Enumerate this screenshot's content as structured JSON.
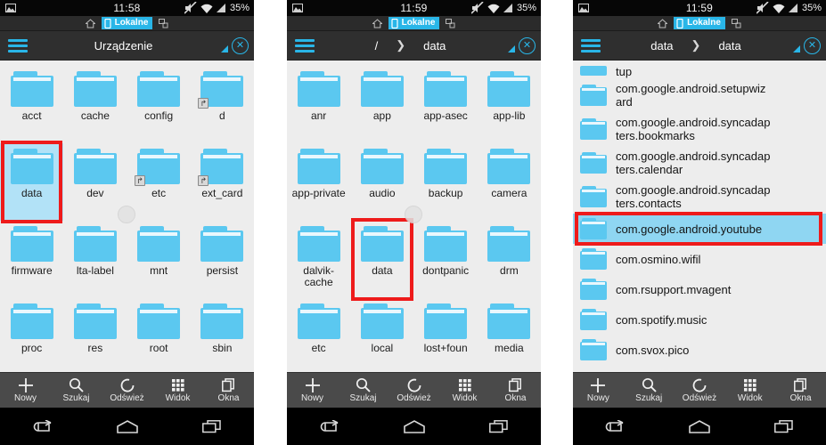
{
  "colors": {
    "accent": "#29b6e8",
    "folder": "#5bc8f0",
    "selection": "#b2e2f7",
    "annotation": "#ee1b1b",
    "content_bg": "#ededed",
    "header_bg": "#2f2f2f",
    "toolbar_bg": "#4a4a4a"
  },
  "statusbar": {
    "clock_panel1": "11:58",
    "clock_panel2": "11:59",
    "clock_panel3": "11:59",
    "battery": "35%",
    "icons": {
      "left": "picture-icon",
      "mute": "mute-icon",
      "wifi": "wifi-icon",
      "signal": "signal-icon"
    }
  },
  "tabstrip": {
    "home_icon": "home-icon",
    "local_tab": "Lokalne",
    "local_icon": "phone-icon",
    "lan_icon": "lan-icon"
  },
  "header": {
    "menu_icon": "hamburger-icon",
    "resize_icon": "resize-handle-icon",
    "close_icon": "close-icon",
    "separator": "❯"
  },
  "toolbar": {
    "items": [
      {
        "label": "Nowy",
        "icon": "plus-icon"
      },
      {
        "label": "Szukaj",
        "icon": "search-icon"
      },
      {
        "label": "Odśwież",
        "icon": "refresh-icon"
      },
      {
        "label": "Widok",
        "icon": "grid-icon"
      },
      {
        "label": "Okna",
        "icon": "windows-icon"
      }
    ]
  },
  "navbar": {
    "back_icon": "back-arrow-icon",
    "home_icon": "home-outline-icon",
    "recents_icon": "recents-icon"
  },
  "panels": [
    {
      "id": "panel1",
      "view": "grid",
      "breadcrumb": [
        "Urządzenie"
      ],
      "items": [
        {
          "name": "acct",
          "link": false,
          "selected": false,
          "marked": false
        },
        {
          "name": "cache",
          "link": false,
          "selected": false,
          "marked": false
        },
        {
          "name": "config",
          "link": false,
          "selected": false,
          "marked": false
        },
        {
          "name": "d",
          "link": true,
          "selected": false,
          "marked": false
        },
        {
          "name": "data",
          "link": false,
          "selected": true,
          "marked": true
        },
        {
          "name": "dev",
          "link": false,
          "selected": false,
          "marked": false
        },
        {
          "name": "etc",
          "link": true,
          "selected": false,
          "marked": false
        },
        {
          "name": "ext_card",
          "link": true,
          "selected": false,
          "marked": false
        },
        {
          "name": "firmware",
          "link": false,
          "selected": false,
          "marked": false
        },
        {
          "name": "lta-label",
          "link": false,
          "selected": false,
          "marked": false
        },
        {
          "name": "mnt",
          "link": false,
          "selected": false,
          "marked": false
        },
        {
          "name": "persist",
          "link": false,
          "selected": false,
          "marked": false
        },
        {
          "name": "proc",
          "link": false,
          "selected": false,
          "marked": false
        },
        {
          "name": "res",
          "link": false,
          "selected": false,
          "marked": false
        },
        {
          "name": "root",
          "link": false,
          "selected": false,
          "marked": false
        },
        {
          "name": "sbin",
          "link": false,
          "selected": false,
          "marked": false
        }
      ]
    },
    {
      "id": "panel2",
      "view": "grid",
      "breadcrumb": [
        "/",
        "data"
      ],
      "items": [
        {
          "name": "anr",
          "link": false,
          "selected": false,
          "marked": false
        },
        {
          "name": "app",
          "link": false,
          "selected": false,
          "marked": false
        },
        {
          "name": "app-asec",
          "link": false,
          "selected": false,
          "marked": false
        },
        {
          "name": "app-lib",
          "link": false,
          "selected": false,
          "marked": false
        },
        {
          "name": "app-private",
          "link": false,
          "selected": false,
          "marked": false
        },
        {
          "name": "audio",
          "link": false,
          "selected": false,
          "marked": false
        },
        {
          "name": "backup",
          "link": false,
          "selected": false,
          "marked": false
        },
        {
          "name": "camera",
          "link": false,
          "selected": false,
          "marked": false
        },
        {
          "name": "dalvik-cache",
          "link": false,
          "selected": false,
          "marked": false
        },
        {
          "name": "data",
          "link": false,
          "selected": false,
          "marked": true
        },
        {
          "name": "dontpanic",
          "link": false,
          "selected": false,
          "marked": false
        },
        {
          "name": "drm",
          "link": false,
          "selected": false,
          "marked": false
        },
        {
          "name": "etc",
          "link": false,
          "selected": false,
          "marked": false
        },
        {
          "name": "local",
          "link": false,
          "selected": false,
          "marked": false
        },
        {
          "name": "lost+foun",
          "link": false,
          "selected": false,
          "marked": false
        },
        {
          "name": "media",
          "link": false,
          "selected": false,
          "marked": false
        }
      ]
    },
    {
      "id": "panel3",
      "view": "list",
      "breadcrumb": [
        "data",
        "data"
      ],
      "items": [
        {
          "name": "tup",
          "clipped": true,
          "selected": false,
          "marked": false
        },
        {
          "name": "com.google.android.setupwiz\nard",
          "clipped": false,
          "selected": false,
          "marked": false
        },
        {
          "name": "com.google.android.syncadap\nters.bookmarks",
          "clipped": false,
          "selected": false,
          "marked": false
        },
        {
          "name": "com.google.android.syncadap\nters.calendar",
          "clipped": false,
          "selected": false,
          "marked": false
        },
        {
          "name": "com.google.android.syncadap\nters.contacts",
          "clipped": false,
          "selected": false,
          "marked": false
        },
        {
          "name": "com.google.android.youtube",
          "clipped": false,
          "selected": true,
          "marked": true
        },
        {
          "name": "com.osmino.wifil",
          "clipped": false,
          "selected": false,
          "marked": false
        },
        {
          "name": "com.rsupport.mvagent",
          "clipped": false,
          "selected": false,
          "marked": false
        },
        {
          "name": "com.spotify.music",
          "clipped": false,
          "selected": false,
          "marked": false
        },
        {
          "name": "com.svox.pico",
          "clipped": false,
          "selected": false,
          "marked": false
        }
      ]
    }
  ]
}
